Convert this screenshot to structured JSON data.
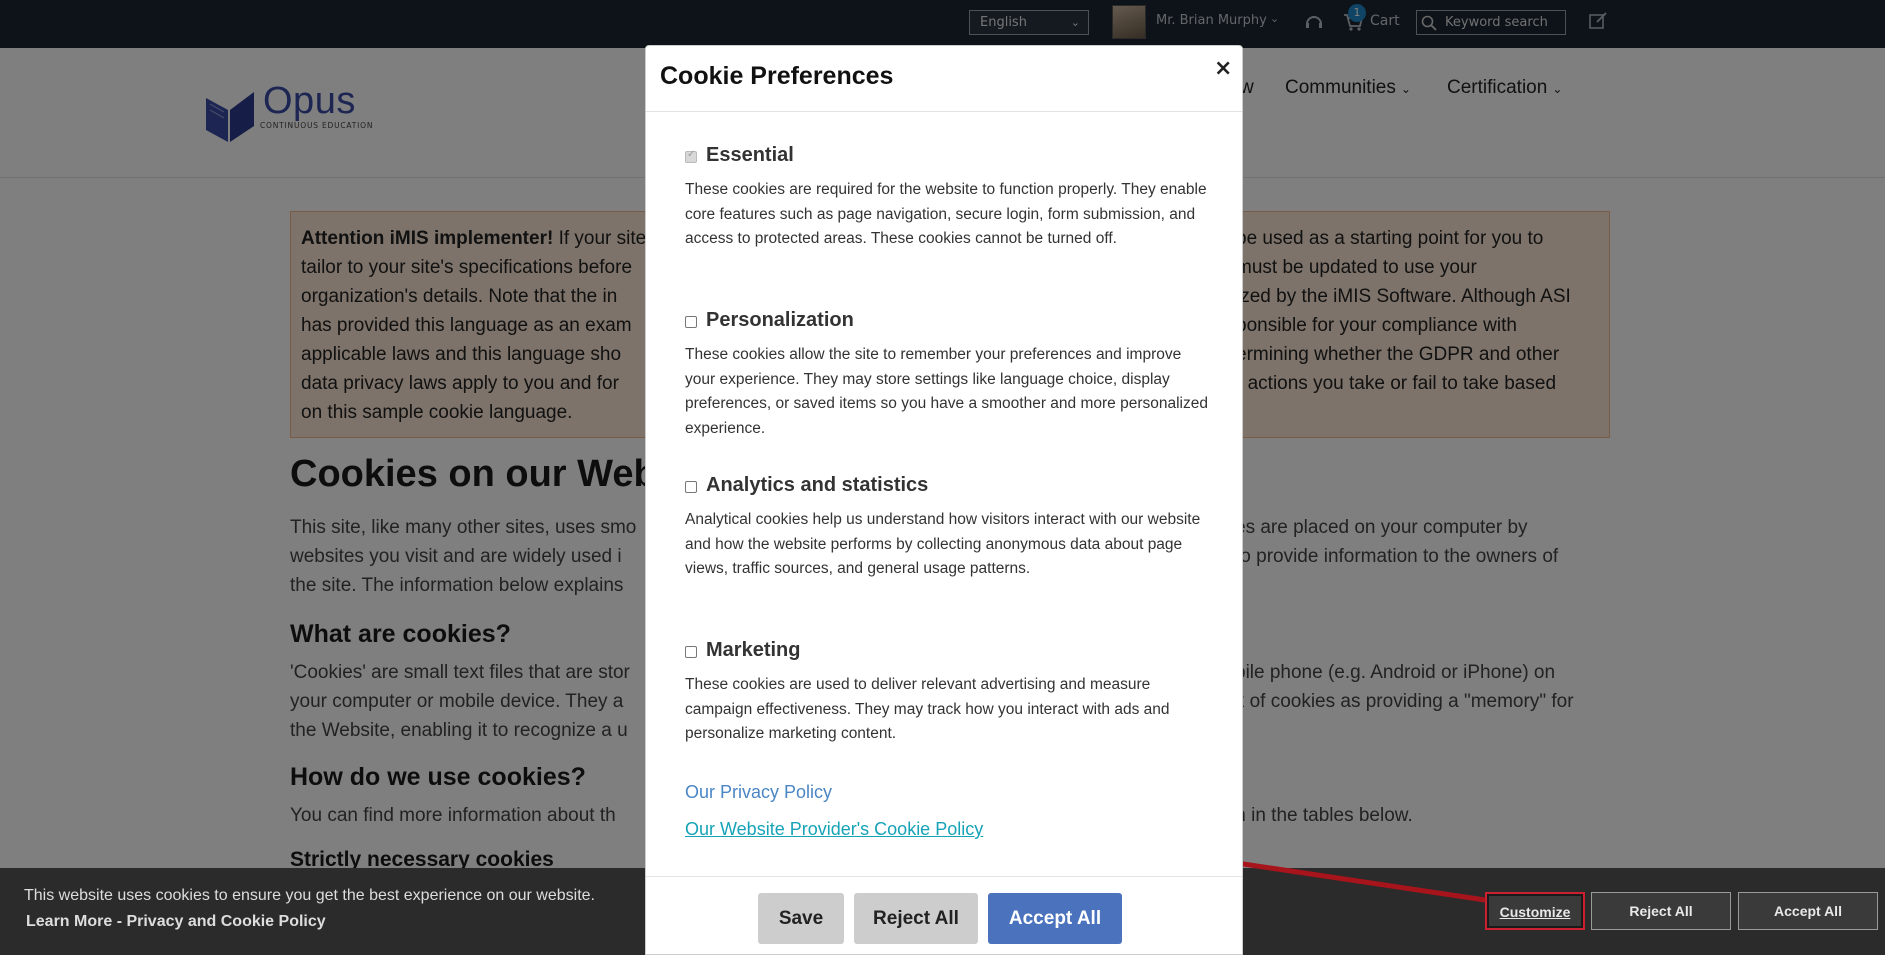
{
  "topbar": {
    "language": "English",
    "user_name": "Mr. Brian Murphy",
    "cart_count": "1",
    "cart_label": "Cart",
    "search_placeholder": "Keyword search"
  },
  "header": {
    "logo_text": "Opus",
    "logo_subtitle": "CONTINUOUS   EDUCATION",
    "nav": [
      {
        "label": "w"
      },
      {
        "label": "Communities"
      },
      {
        "label": "Certification"
      }
    ]
  },
  "page": {
    "notice_bold": "Attention iMIS implementer!",
    "notice_lines": [
      " If your site",
      "tailor to your site's specifications before",
      "organization's details.  Note that the in",
      "has provided this language as an exam",
      "applicable laws and this language sho",
      "data privacy laws apply to you and for",
      "on this sample cookie language."
    ],
    "notice_right_lines": [
      "be used as a starting point for you to",
      "must be updated to use your",
      "ized by the iMIS Software.  Although ASI",
      "ponsible for your compliance with",
      "ermining whether the GDPR and other",
      "r actions you take or fail to take based",
      ""
    ],
    "h1": "Cookies on our Web",
    "p1_left": [
      "This site, like many other sites, uses smo",
      "websites you visit and are widely used i",
      "the site.  The information below explains"
    ],
    "p1_right": [
      "es are placed on your computer by",
      "to provide information to the owners of",
      ""
    ],
    "h2_what": "What are cookies?",
    "p2_left": [
      "'Cookies' are small text files that are stor",
      "your computer or mobile device. They a",
      "the Website, enabling it to recognize a u"
    ],
    "p2_right": [
      "bile phone (e.g. Android or iPhone) on",
      "ink of cookies as providing a \"memory\" for",
      ""
    ],
    "h2_how": "How do we use cookies?",
    "p3_left": "You can find more information about th",
    "p3_right": "m in the tables below.",
    "h3_strict": "Strictly necessary cookies"
  },
  "modal": {
    "title": "Cookie Preferences",
    "close": "×",
    "sections": [
      {
        "title": "Essential",
        "desc": "These cookies are required for the website to function properly. They enable core features such as page navigation, secure login, form submission, and access to protected areas. These cookies cannot be turned off.",
        "checked": true,
        "disabled": true
      },
      {
        "title": "Personalization",
        "desc": "These cookies allow the site to remember your preferences and improve your experience. They may store settings like language choice, display preferences, or saved items so you have a smoother and more personalized experience.",
        "checked": false,
        "disabled": false
      },
      {
        "title": "Analytics and statistics",
        "desc": "Analytical cookies help us understand how visitors interact with our website and how the website performs by collecting anonymous data about page views, traffic sources, and general usage patterns.",
        "checked": false,
        "disabled": false
      },
      {
        "title": "Marketing",
        "desc": "These cookies are used to deliver relevant advertising and measure campaign effectiveness. They may track how you interact with ads and personalize marketing content.",
        "checked": false,
        "disabled": false
      }
    ],
    "privacy_link": "Our Privacy Policy",
    "provider_link": "Our Website Provider's Cookie Policy",
    "buttons": {
      "save": "Save",
      "reject": "Reject All",
      "accept": "Accept All"
    }
  },
  "cookie_bar": {
    "message": "This website uses cookies to ensure you get the best experience on our website.",
    "learn_more": "Learn More - Privacy and Cookie Policy",
    "customize": "Customize",
    "reject": "Reject All",
    "accept": "Accept All"
  },
  "colors": {
    "topbar": "#1d2633",
    "accent_blue": "#4a72bd",
    "annotation_red": "#cc2030"
  }
}
